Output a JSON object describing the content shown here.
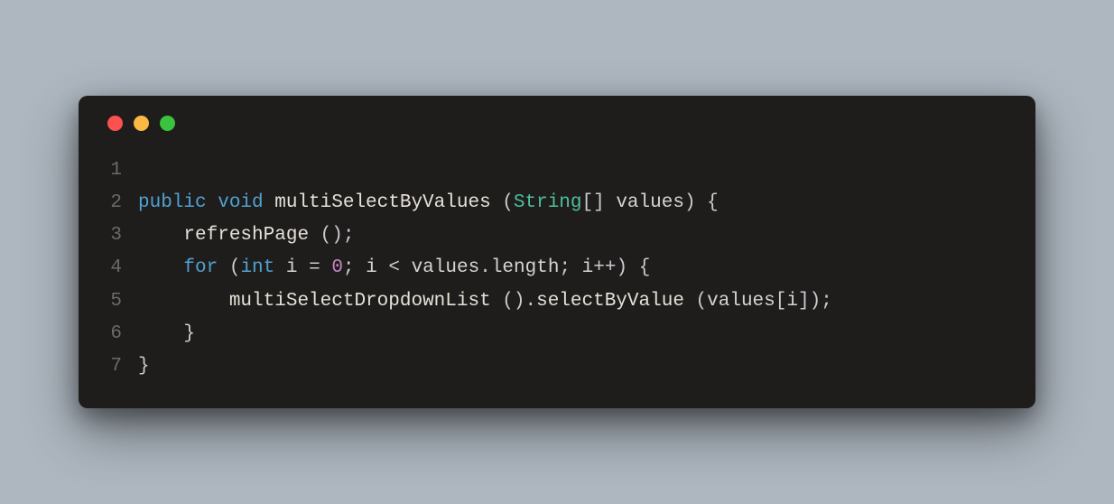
{
  "window": {
    "traffic_lights": {
      "close": "#fb524f",
      "minimize": "#fbb843",
      "zoom": "#3ac33e"
    }
  },
  "code": {
    "lines": [
      {
        "num": "1",
        "tokens": [
          {
            "t": "",
            "c": "punct"
          }
        ]
      },
      {
        "num": "2",
        "tokens": [
          {
            "t": "public ",
            "c": "kw"
          },
          {
            "t": "void ",
            "c": "kw"
          },
          {
            "t": "multiSelectByValues ",
            "c": "fn"
          },
          {
            "t": "(",
            "c": "punct"
          },
          {
            "t": "String",
            "c": "type"
          },
          {
            "t": "[] ",
            "c": "punct"
          },
          {
            "t": "values",
            "c": "id"
          },
          {
            "t": ") {",
            "c": "punct"
          }
        ]
      },
      {
        "num": "3",
        "tokens": [
          {
            "t": "    ",
            "c": "punct"
          },
          {
            "t": "refreshPage ",
            "c": "fn"
          },
          {
            "t": "();",
            "c": "punct"
          }
        ]
      },
      {
        "num": "4",
        "tokens": [
          {
            "t": "    ",
            "c": "punct"
          },
          {
            "t": "for ",
            "c": "kw"
          },
          {
            "t": "(",
            "c": "punct"
          },
          {
            "t": "int ",
            "c": "kw"
          },
          {
            "t": "i ",
            "c": "id"
          },
          {
            "t": "= ",
            "c": "op"
          },
          {
            "t": "0",
            "c": "num"
          },
          {
            "t": "; ",
            "c": "punct"
          },
          {
            "t": "i ",
            "c": "id"
          },
          {
            "t": "< ",
            "c": "op"
          },
          {
            "t": "values",
            "c": "id"
          },
          {
            "t": ".",
            "c": "punct"
          },
          {
            "t": "length",
            "c": "id"
          },
          {
            "t": "; ",
            "c": "punct"
          },
          {
            "t": "i",
            "c": "id"
          },
          {
            "t": "++",
            "c": "op"
          },
          {
            "t": ") {",
            "c": "punct"
          }
        ]
      },
      {
        "num": "5",
        "tokens": [
          {
            "t": "        ",
            "c": "punct"
          },
          {
            "t": "multiSelectDropdownList ",
            "c": "fn"
          },
          {
            "t": "().",
            "c": "punct"
          },
          {
            "t": "selectByValue ",
            "c": "fn"
          },
          {
            "t": "(",
            "c": "punct"
          },
          {
            "t": "values",
            "c": "id"
          },
          {
            "t": "[",
            "c": "punct"
          },
          {
            "t": "i",
            "c": "id"
          },
          {
            "t": "]);",
            "c": "punct"
          }
        ]
      },
      {
        "num": "6",
        "tokens": [
          {
            "t": "    }",
            "c": "punct"
          }
        ]
      },
      {
        "num": "7",
        "tokens": [
          {
            "t": "}",
            "c": "punct"
          }
        ]
      }
    ]
  }
}
